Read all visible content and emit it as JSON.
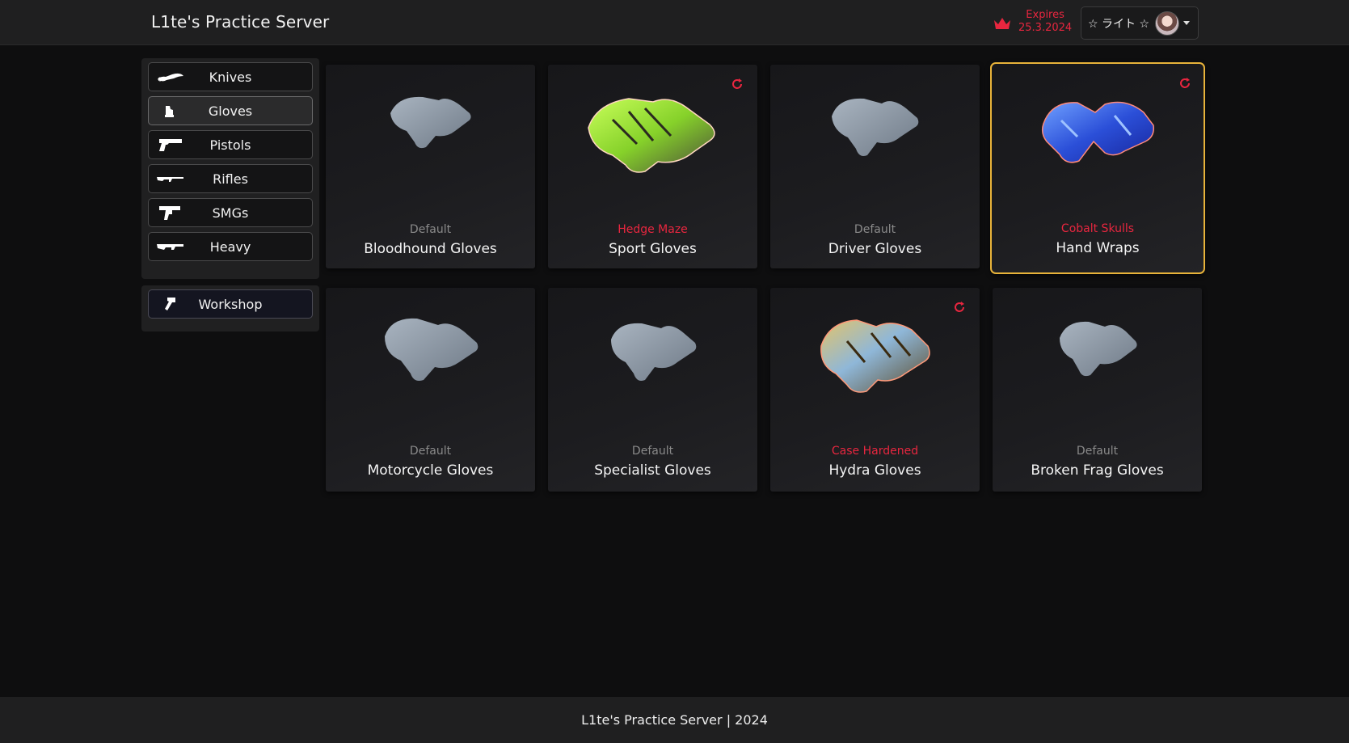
{
  "header": {
    "title": "L1te's Practice Server",
    "expires_label": "Expires",
    "expires_date": "25.3.2024",
    "username": "☆ ライト ☆"
  },
  "sidebar": {
    "categories": [
      {
        "label": "Knives",
        "icon": "knife-icon"
      },
      {
        "label": "Gloves",
        "icon": "glove-icon",
        "active": true
      },
      {
        "label": "Pistols",
        "icon": "pistol-icon"
      },
      {
        "label": "Rifles",
        "icon": "rifle-icon"
      },
      {
        "label": "SMGs",
        "icon": "smg-icon"
      },
      {
        "label": "Heavy",
        "icon": "heavy-icon"
      }
    ],
    "workshop_label": "Workshop"
  },
  "cards": [
    {
      "skin": "Default",
      "name": "Bloodhound Gloves",
      "style": "default",
      "image": "default-glove"
    },
    {
      "skin": "Hedge Maze",
      "name": "Sport Gloves",
      "style": "red",
      "image": "sport-gloves-hedge-maze",
      "resettable": true
    },
    {
      "skin": "Default",
      "name": "Driver Gloves",
      "style": "default",
      "image": "default-glove"
    },
    {
      "skin": "Cobalt Skulls",
      "name": "Hand Wraps",
      "style": "red",
      "image": "hand-wraps-cobalt-skulls",
      "resettable": true,
      "selected": true
    },
    {
      "skin": "Default",
      "name": "Motorcycle Gloves",
      "style": "default",
      "image": "default-glove"
    },
    {
      "skin": "Default",
      "name": "Specialist Gloves",
      "style": "default",
      "image": "default-glove"
    },
    {
      "skin": "Case Hardened",
      "name": "Hydra Gloves",
      "style": "red",
      "image": "hydra-gloves-case-hardened",
      "resettable": true
    },
    {
      "skin": "Default",
      "name": "Broken Frag Gloves",
      "style": "default",
      "image": "default-glove"
    }
  ],
  "footer": {
    "text": "L1te's Practice Server | 2024"
  },
  "colors": {
    "accent_red": "#e8263f",
    "selected_border": "#e8b33a",
    "background": "#0e0e0f"
  }
}
